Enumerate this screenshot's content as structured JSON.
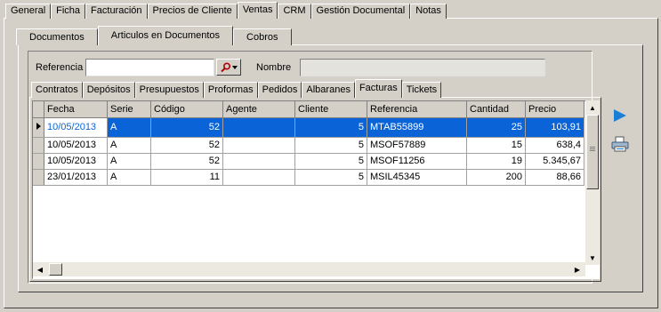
{
  "main_tabs": [
    "General",
    "Ficha",
    "Facturación",
    "Precios de Cliente",
    "Ventas",
    "CRM",
    "Gestión Documental",
    "Notas"
  ],
  "main_active": "Ventas",
  "sub_tabs": [
    "Documentos",
    "Articulos en Documentos",
    "Cobros"
  ],
  "sub_active": "Articulos en Documentos",
  "search": {
    "referencia_label": "Referencia",
    "referencia_value": "",
    "nombre_label": "Nombre",
    "nombre_value": ""
  },
  "doc_tabs": [
    "Contratos",
    "Depósitos",
    "Presupuestos",
    "Proformas",
    "Pedidos",
    "Albaranes",
    "Facturas",
    "Tickets"
  ],
  "doc_active": "Facturas",
  "grid": {
    "columns": [
      "Fecha",
      "Serie",
      "Código",
      "Agente",
      "Cliente",
      "Referencia",
      "Cantidad",
      "Precio"
    ],
    "rows": [
      {
        "fecha": "10/05/2013",
        "serie": "A",
        "codigo": "52",
        "agente": "",
        "cliente": "5",
        "referencia": "MTAB55899",
        "cantidad": "25",
        "precio": "103,91"
      },
      {
        "fecha": "10/05/2013",
        "serie": "A",
        "codigo": "52",
        "agente": "",
        "cliente": "5",
        "referencia": "MSOF57889",
        "cantidad": "15",
        "precio": "638,4"
      },
      {
        "fecha": "10/05/2013",
        "serie": "A",
        "codigo": "52",
        "agente": "",
        "cliente": "5",
        "referencia": "MSOF11256",
        "cantidad": "19",
        "precio": "5.345,67"
      },
      {
        "fecha": "23/01/2013",
        "serie": "A",
        "codigo": "11",
        "agente": "",
        "cliente": "5",
        "referencia": "MSIL45345",
        "cantidad": "200",
        "precio": "88,66"
      }
    ],
    "selected_row": 0
  },
  "side_icons": [
    "play-icon",
    "printer-icon"
  ],
  "colors": {
    "selection": "#0a64d7",
    "background": "#d4d0c8"
  }
}
